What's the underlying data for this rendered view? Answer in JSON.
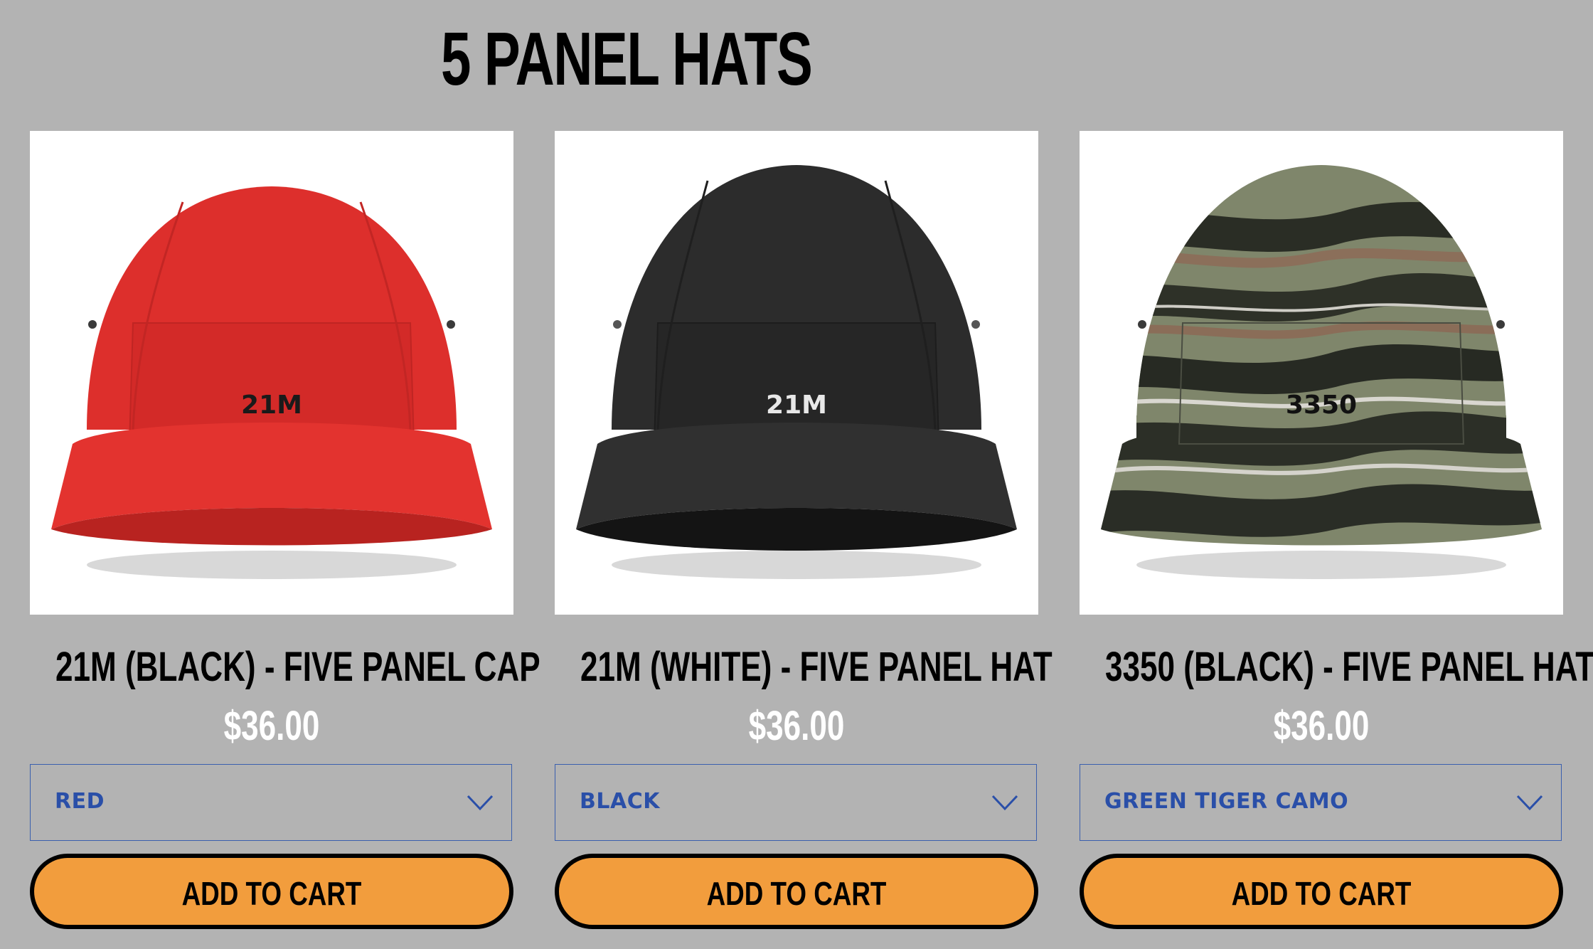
{
  "page": {
    "title": "5 PANEL HATS",
    "background": "#b3b3b3"
  },
  "products": [
    {
      "title": "21M (BLACK) - FIVE PANEL CAP",
      "price": "$36.00",
      "hat_text": "21M",
      "hat_color": "#e0312e",
      "hat_text_color": "#1a1a1a",
      "variant": "RED",
      "button": "ADD TO CART"
    },
    {
      "title": "21M (WHITE) - FIVE PANEL HAT",
      "price": "$36.00",
      "hat_text": "21M",
      "hat_color": "#2b2b2b",
      "hat_text_color": "#e8e8e8",
      "variant": "BLACK",
      "button": "ADD TO CART"
    },
    {
      "title": "3350 (BLACK) - FIVE PANEL HAT",
      "price": "$36.00",
      "hat_text": "3350",
      "hat_color": "#7d8468",
      "hat_text_color": "#111111",
      "variant": "GREEN TIGER CAMO",
      "button": "ADD TO CART"
    }
  ],
  "colors": {
    "button_fill": "#f29d3d",
    "select_text": "#2a4fa8",
    "price_text": "#ffffff"
  },
  "icons": {
    "select_arrow": "chevron-down-icon"
  }
}
